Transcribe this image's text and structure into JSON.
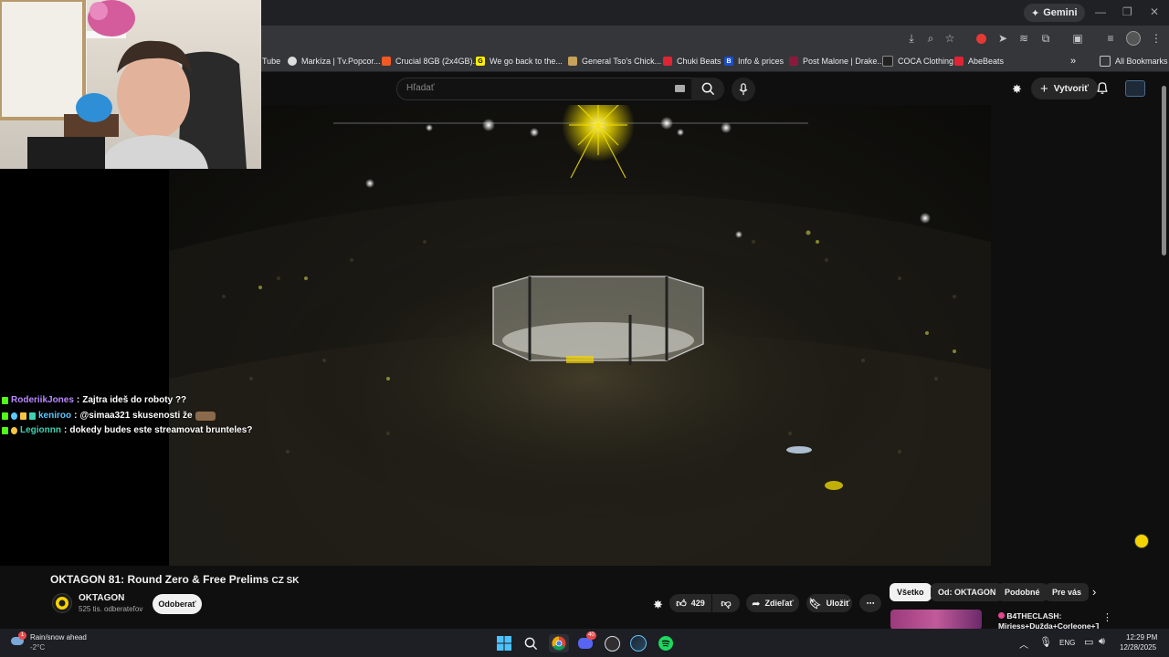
{
  "browser": {
    "gemini_label": "Gemini",
    "bookmarks": [
      {
        "label": "Tube",
        "color": "#ff0000"
      },
      {
        "label": "Markíza | Tv.Popcor...",
        "color": "#dddddd"
      },
      {
        "label": "Crucial 8GB (2x4GB)...",
        "color": "#f15a24"
      },
      {
        "label": "We go back to the...",
        "color": "#1a1a1a"
      },
      {
        "label": "General Tso's Chick...",
        "color": "#c8a25c"
      },
      {
        "label": "Chuki Beats",
        "color": "#e02434"
      },
      {
        "label": "Info & prices",
        "color": "#1b4fd1"
      },
      {
        "label": "Post Malone | Drake...",
        "color": "#8b1a3a"
      },
      {
        "label": "COCA Clothing",
        "color": "#222222"
      },
      {
        "label": "AbeBeats",
        "color": "#e02434"
      }
    ],
    "all_bookmarks_label": "All Bookmarks",
    "more_bookmarks_glyph": "»"
  },
  "youtube": {
    "search_placeholder": "Hľadať",
    "create_label": "Vytvoriť",
    "video_title": "OKTAGON 81: Round Zero & Free Prelims",
    "title_suffix": "CZ SK",
    "channel_name": "OKTAGON",
    "subscriber_count": "525 tis. odberateľov",
    "subscribe_label": "Odoberať",
    "like_count": "429",
    "share_label": "Zdieľať",
    "save_label": "Uložiť",
    "chips": [
      "Všetko",
      "Od: OKTAGON",
      "Podobné",
      "Pre vás"
    ],
    "recommendation": {
      "title_line1": "B4THECLASH:",
      "title_line2": "Mirjess+Dužda+Corleone+Tink"
    }
  },
  "chat": [
    {
      "user": "RoderiikJones",
      "user_color": "#b98aff",
      "message": "Zajtra ideš do roboty ??"
    },
    {
      "user": "keniroo",
      "user_color": "#5cc8ff",
      "message": "@simaa321 skusenosti že"
    },
    {
      "user": "Legionnn",
      "user_color": "#3fd2b0",
      "message": "dokedy budes este streamovat brunteles?"
    }
  ],
  "taskbar": {
    "weather_line1": "Rain/snow ahead",
    "weather_line2": "-2°C",
    "weather_badge": "1",
    "discord_badge": "40",
    "language": "ENG",
    "time": "12:29 PM",
    "date": "12/28/2025"
  },
  "colors": {
    "background": "#0f0f0f",
    "chrome_frame": "#202124",
    "chrome_toolbar": "#35363a",
    "oktagon_yellow": "#f5d300",
    "taskbar": "#1d1f24"
  }
}
